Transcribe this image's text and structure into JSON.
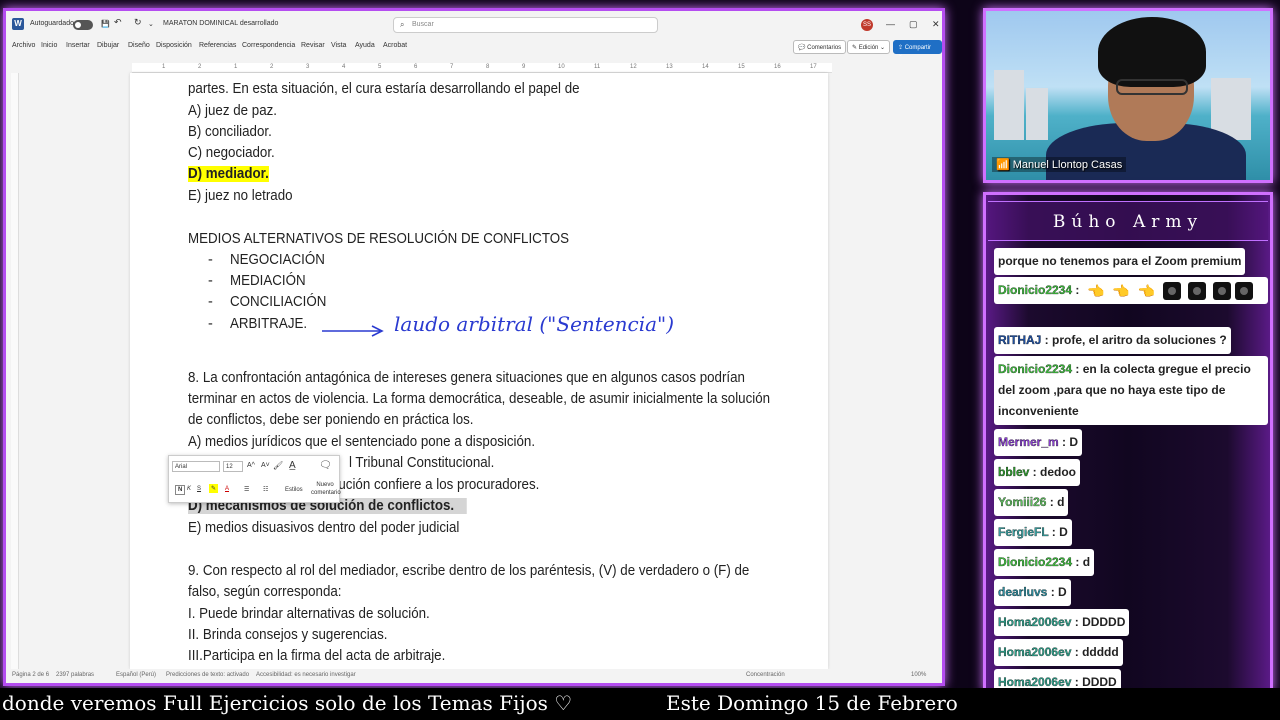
{
  "word": {
    "autosave_label": "Autoguardado",
    "doc_title": "MARATON DOMINICAL desarrollado",
    "search_placeholder": "Buscar",
    "user_initials": "SS",
    "menu": [
      "Archivo",
      "Inicio",
      "Insertar",
      "Dibujar",
      "Diseño",
      "Disposición",
      "Referencias",
      "Correspondencia",
      "Revisar",
      "Vista",
      "Ayuda",
      "Acrobat"
    ],
    "comments_label": "Comentarios",
    "editing_label": "Edición",
    "share_label": "Compartir",
    "ruler_marks": [
      "1",
      "2",
      "1",
      "2",
      "3",
      "4",
      "5",
      "6",
      "7",
      "8",
      "9",
      "10",
      "11",
      "12",
      "13",
      "14",
      "15",
      "16",
      "17"
    ],
    "lines": {
      "l1": "partes. En esta situación, el cura estaría desarrollando el papel de",
      "l2": "A) juez de paz.",
      "l3": "B) conciliador.",
      "l4": "C) negociador.",
      "l5": "D) mediador.",
      "l6": "E) juez no letrado",
      "l7": "MEDIOS ALTERNATIVOS DE RESOLUCIÓN DE CONFLICTOS",
      "l8": "NEGOCIACIÓN",
      "l9": "MEDIACIÓN",
      "l10": "CONCILIACIÓN",
      "l11": "ARBITRAJE.",
      "l12": "8. La confrontación antagónica de intereses genera situaciones que en algunos casos podrían",
      "l13": "terminar en actos de violencia. La forma democrática, deseable, de asumir inicialmente la solución",
      "l14": "de conflictos, debe ser poniendo en práctica los.",
      "l15": "A) medios jurídicos que el sentenciado pone a disposición.",
      "l16": "B) mecanismos dictados por el Tribunal Constitucional.",
      "l16_visible": "l Tribunal Constitucional.",
      "l17_visible": "titución confiere a los procuradores.",
      "l18": "D) mecanismos de solución de conflictos.",
      "l19": "E) medios disuasivos dentro del poder judicial",
      "l20": "9.  Con respecto al rol del mediador, escribe dentro de los paréntesis, (V) de verdadero o (F) de",
      "l21": "falso, según corresponda:",
      "l22": "I.  Puede brindar alternativas de solución.",
      "l23": "II. Brinda consejos y sugerencias.",
      "l24": "III.Participa en la firma del acta de arbitraje."
    },
    "bullet_char": "-",
    "handwriting": "laudo arbitral (\"Sentencia\")",
    "minitoolbar": {
      "font": "Arial",
      "size": "12",
      "styles_label": "Estilos",
      "new_comment_label": "Nuevo comentario"
    },
    "status": {
      "page": "Página 2 de 6",
      "words": "2397 palabras",
      "language": "Español (Perú)",
      "predictions": "Predicciones de texto: activado",
      "accessibility": "Accesibilidad: es necesario investigar",
      "focus": "Concentración",
      "zoom": "100%"
    }
  },
  "webcam": {
    "name": "Manuel Llontop Casas"
  },
  "chat": {
    "title": "Búho Army",
    "messages": [
      {
        "user": "",
        "text": "porque no tenemos para el Zoom premium",
        "color": "#222"
      },
      {
        "user": "Dionicio2234",
        "text": "",
        "color": "#3fbf3f"
      },
      {
        "user": "RITHAJ",
        "text": "profe, el aritro da soluciones ?",
        "color": "#1e4fa0"
      },
      {
        "user": "Dionicio2234",
        "text": "en la colecta gregue el precio del zoom ,para que no haya este tipo de inconveniente",
        "color": "#3fbf3f"
      },
      {
        "user": "Mermer_m",
        "text": "D",
        "color": "#8a3fd1"
      },
      {
        "user": "bblev",
        "text": "dedoo",
        "color": "#2d9a2d"
      },
      {
        "user": "Yomiii26",
        "text": "d",
        "color": "#5fbf5f"
      },
      {
        "user": "FergieFL",
        "text": "D",
        "color": "#3aa0a0"
      },
      {
        "user": "Dionicio2234",
        "text": "d",
        "color": "#3fbf3f"
      },
      {
        "user": "dearluvs",
        "text": "D",
        "color": "#2e8fa0"
      },
      {
        "user": "Homa2006ev",
        "text": "DDDDD",
        "color": "#2ea08a"
      },
      {
        "user": "Homa2006ev",
        "text": "ddddd",
        "color": "#2ea08a"
      },
      {
        "user": "Homa2006ev",
        "text": "DDDD",
        "color": "#2ea08a"
      }
    ],
    "separator": " : "
  },
  "ticker": {
    "left": "donde veremos Full Ejercicios solo de los Temas Fijos ♡",
    "right": "Este Domingo 15 de Febrero"
  }
}
